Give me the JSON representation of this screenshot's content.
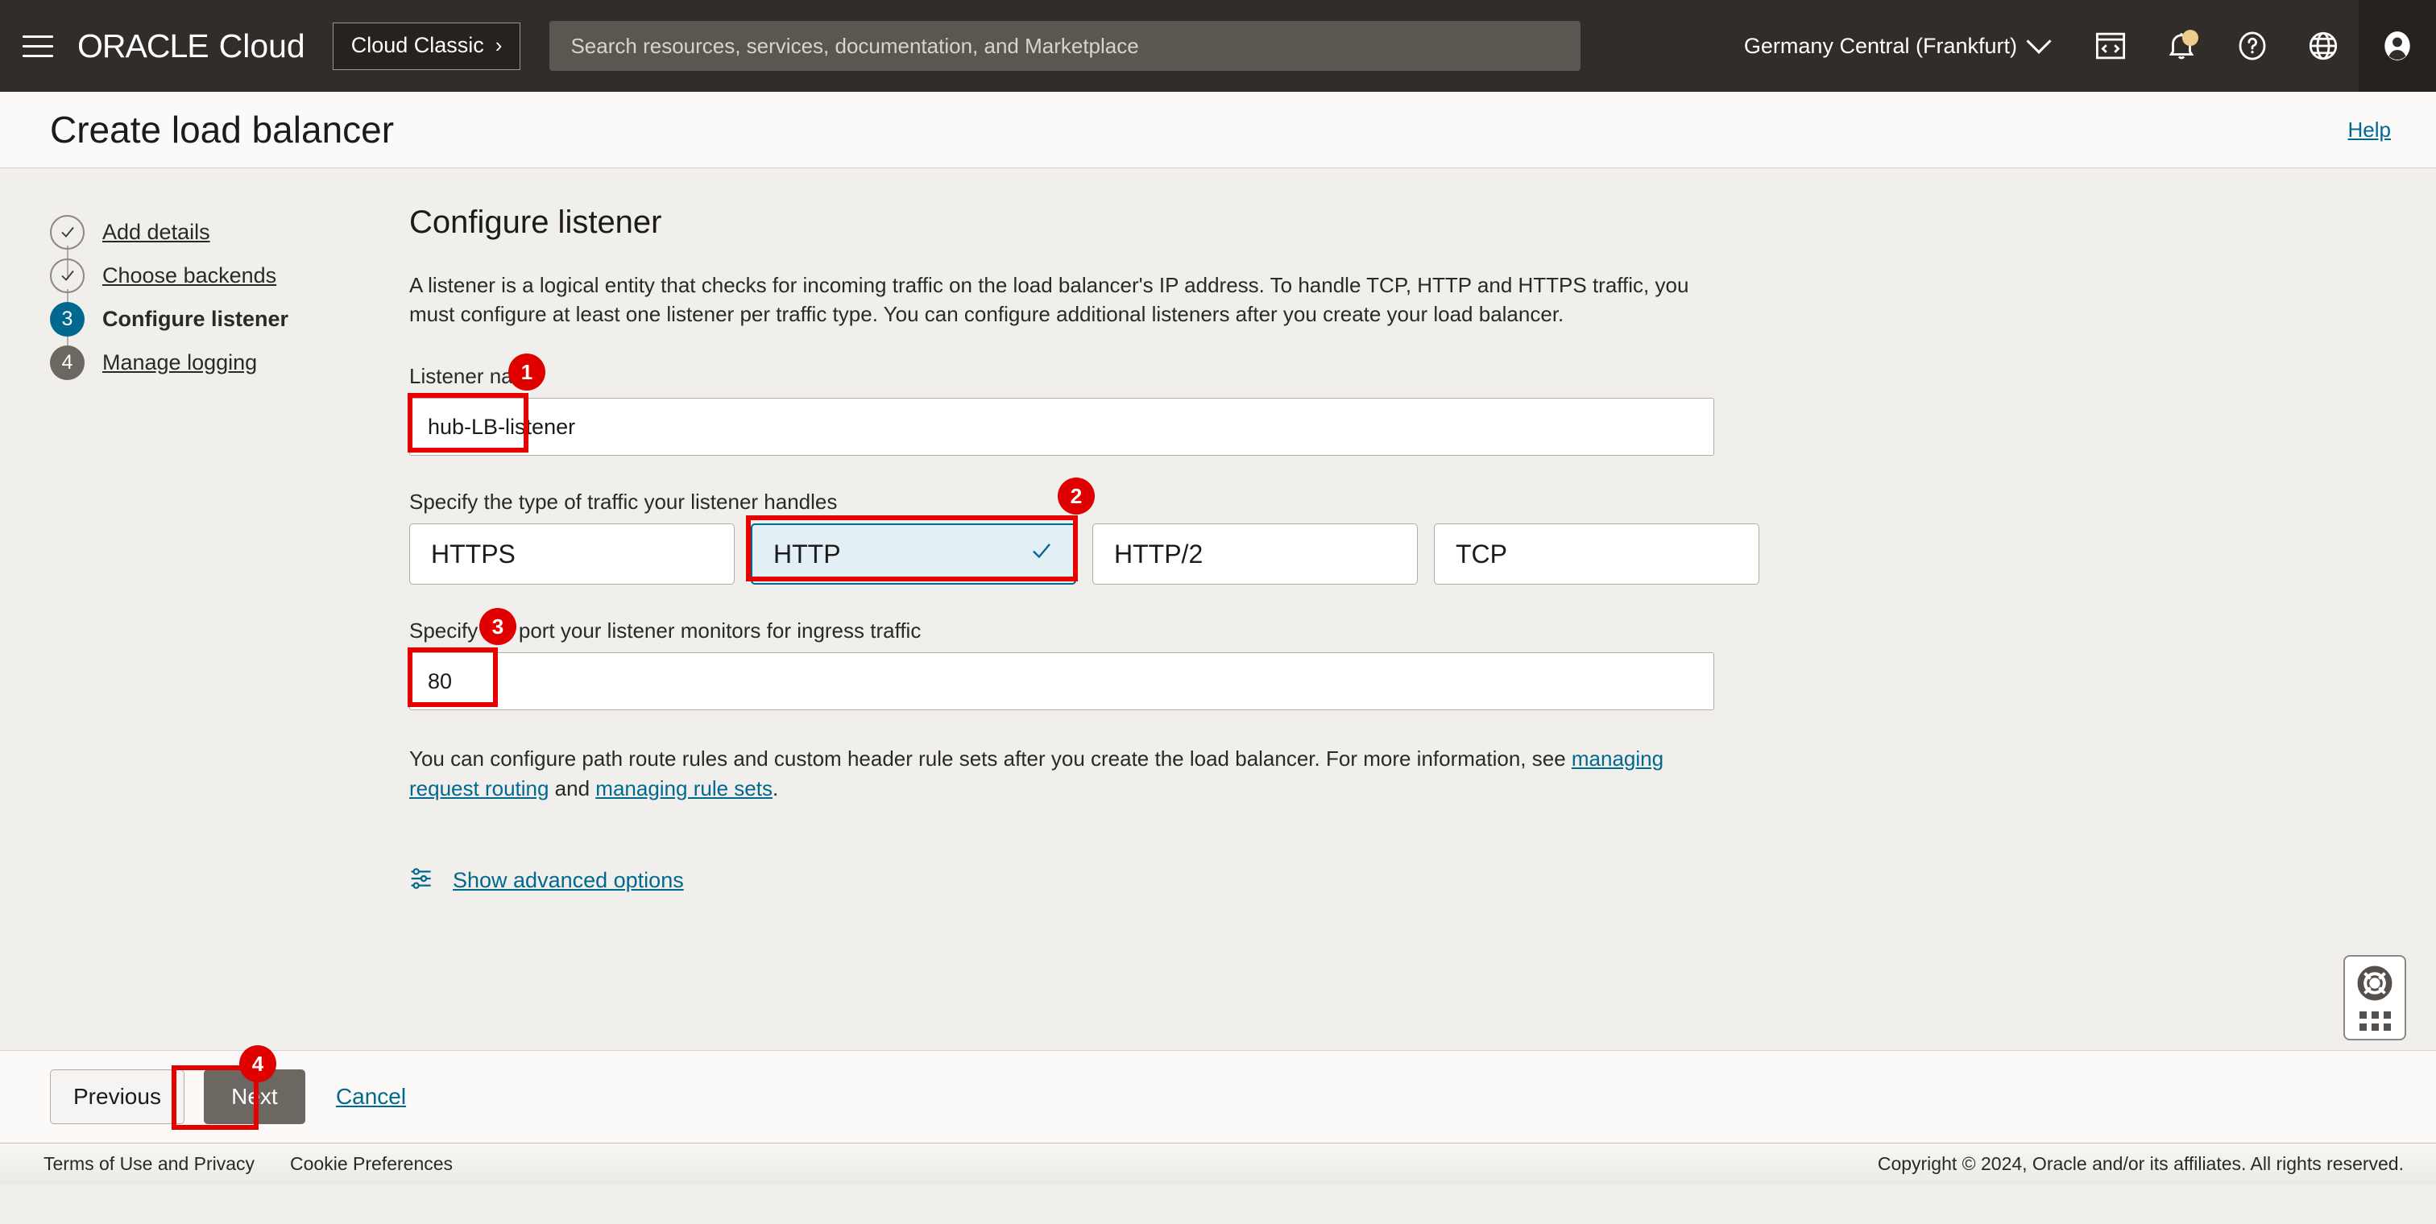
{
  "topnav": {
    "menu_icon": "hamburger-menu-icon",
    "brand_oracle": "ORACLE",
    "brand_cloud": "Cloud",
    "cloud_classic_label": "Cloud Classic",
    "cloud_classic_chevron": "›",
    "search_placeholder": "Search resources, services, documentation, and Marketplace",
    "search_value": "",
    "region": "Germany Central (Frankfurt)",
    "icons": [
      "cloud-shell-icon",
      "notifications-bell-icon",
      "help-question-icon",
      "language-globe-icon",
      "user-avatar-icon"
    ]
  },
  "page_header": {
    "title": "Create load balancer",
    "help_label": "Help"
  },
  "steps": [
    {
      "number": "1",
      "label": "Add details",
      "state": "done"
    },
    {
      "number": "2",
      "label": "Choose backends",
      "state": "done"
    },
    {
      "number": "3",
      "label": "Configure listener",
      "state": "active"
    },
    {
      "number": "4",
      "label": "Manage logging",
      "state": "pending"
    }
  ],
  "main": {
    "section_title": "Configure listener",
    "description": "A listener is a logical entity that checks for incoming traffic on the load balancer's IP address. To handle TCP, HTTP and HTTPS traffic, you must configure at least one listener per traffic type. You can configure additional listeners after you create your load balancer.",
    "listener_name_label": "Listener name",
    "listener_name_value": "hub-LB-listener",
    "traffic_type_label": "Specify the type of traffic your listener handles",
    "traffic_types": [
      {
        "label": "HTTPS",
        "selected": false
      },
      {
        "label": "HTTP",
        "selected": true
      },
      {
        "label": "HTTP/2",
        "selected": false
      },
      {
        "label": "TCP",
        "selected": false
      }
    ],
    "port_label": "Specify the port your listener monitors for ingress traffic",
    "port_value": "80",
    "helper_prefix": "You can configure path route rules and custom header rule sets after you create the load balancer. For more information, see ",
    "helper_link1": "managing request routing",
    "helper_middle": " and ",
    "helper_link2": "managing rule sets",
    "helper_suffix": ".",
    "advanced_options_label": "Show advanced options",
    "advanced_options_icon": "sliders-settings-icon"
  },
  "annotations": [
    {
      "id": "1",
      "target": "listener-name-input"
    },
    {
      "id": "2",
      "target": "traffic-type-http-tile"
    },
    {
      "id": "3",
      "target": "port-input"
    },
    {
      "id": "4",
      "target": "next-button"
    }
  ],
  "support_widget": {
    "icon": "life-preserver-support-icon",
    "grid_icon": "dots-grid-icon"
  },
  "action_bar": {
    "previous_label": "Previous",
    "next_label": "Next",
    "cancel_label": "Cancel"
  },
  "footer": {
    "terms_label": "Terms of Use and Privacy",
    "cookie_label": "Cookie Preferences",
    "copyright": "Copyright © 2024, Oracle and/or its affiliates. All rights reserved."
  },
  "colors": {
    "nav_bg": "#312d2a",
    "accent_link": "#01688f",
    "step_active": "#01688f",
    "step_pending": "#6d6761",
    "annotation_red": "#e00000",
    "tile_selected_bg": "#e2eff4",
    "page_bg": "#f1efec"
  }
}
